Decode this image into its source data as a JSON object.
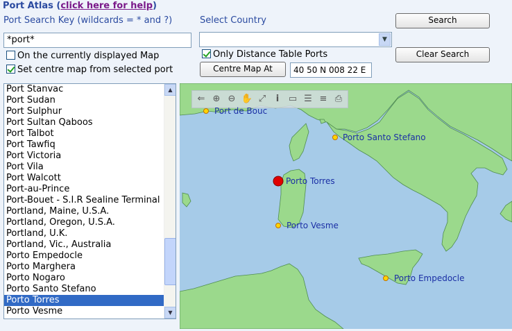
{
  "header": {
    "title": "Port Atlas",
    "help_link": "click here for help"
  },
  "search": {
    "key_label": "Port Search Key (wildcards = * and ?)",
    "key_value": "*port*",
    "country_label": "Select Country",
    "country_value": ""
  },
  "buttons": {
    "search": "Search",
    "clear_search": "Clear Search",
    "centre_map_at": "Centre Map At"
  },
  "options": {
    "on_displayed_map": {
      "label": "On the currently displayed Map",
      "checked": false
    },
    "set_centre": {
      "label": "Set centre map from selected port",
      "checked": true
    },
    "only_distance_ports": {
      "label": "Only Distance Table Ports",
      "checked": true
    }
  },
  "centre_coords": "40 50 N 008 22 E",
  "port_list": {
    "items": [
      "Port Stanvac",
      "Port Sudan",
      "Port Sulphur",
      "Port Sultan Qaboos",
      "Port Talbot",
      "Port Tawfiq",
      "Port Victoria",
      "Port Vila",
      "Port Walcott",
      "Port-au-Prince",
      "Port-Bouet - S.I.R Sealine Terminal",
      "Portland, Maine, U.S.A.",
      "Portland, Oregon, U.S.A.",
      "Portland, U.K.",
      "Portland, Vic., Australia",
      "Porto Empedocle",
      "Porto Marghera",
      "Porto Nogaro",
      "Porto Santo Stefano",
      "Porto Torres",
      "Porto Vesme"
    ],
    "selected": "Porto Torres"
  },
  "map": {
    "toolbar_icons": [
      "back-arrow-icon",
      "zoom-in-icon",
      "zoom-out-icon",
      "pan-hand-icon",
      "full-extent-icon",
      "info-icon",
      "measure-icon",
      "layers-icon",
      "list-icon",
      "print-icon"
    ],
    "ports": [
      {
        "name": "Port de Bouc",
        "selected": false
      },
      {
        "name": "Porto Santo Stefano",
        "selected": false
      },
      {
        "name": "Porto Torres",
        "selected": true
      },
      {
        "name": "Porto Vesme",
        "selected": false
      },
      {
        "name": "Porto Empedocle",
        "selected": false
      }
    ],
    "colors": {
      "sea": "#a6cbe8",
      "land": "#9bd98c",
      "port_marker": "#ffd400",
      "selected_marker": "#e00000",
      "label": "#1b2fa5"
    }
  }
}
